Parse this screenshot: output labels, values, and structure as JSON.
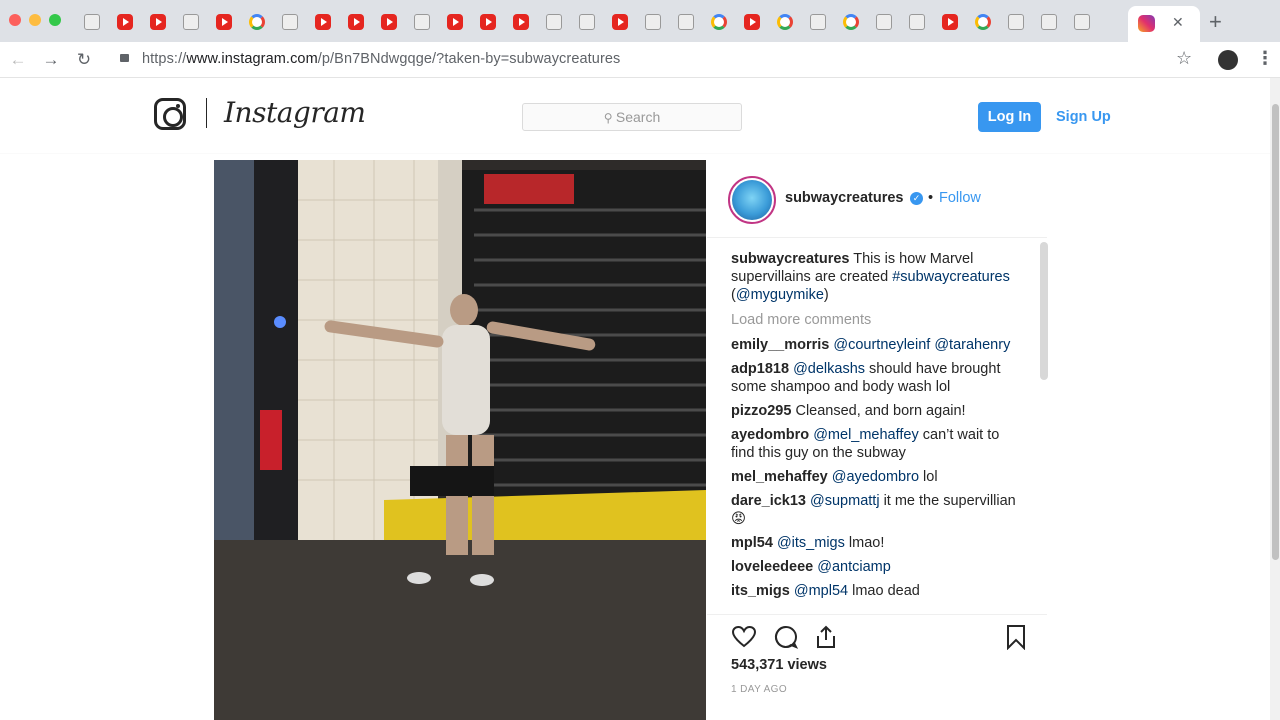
{
  "browser": {
    "url_prefix": "https://",
    "url_domain": "www.instagram.com",
    "url_path": "/p/Bn7BNdwgqge/?taken-by=subwaycreatures",
    "tab_close": "✕",
    "new_tab": "+"
  },
  "header": {
    "wordmark": "Instagram",
    "search_placeholder": "Search",
    "login_label": "Log In",
    "signup_label": "Sign Up"
  },
  "post": {
    "author": "subwaycreatures",
    "separator": "•",
    "follow_label": "Follow",
    "views": "543,371 views",
    "time": "1 DAY AGO",
    "caption": {
      "user": "subwaycreatures",
      "text": " This is how Marvel supervillains are created ",
      "hashtag": "#subwaycreatures",
      "open": " (",
      "mention": "@myguymike",
      "close": ")"
    },
    "load_more": "Load more comments",
    "comments": [
      {
        "user": "emily__morris",
        "mention": "@courtneyleinf @tarahenry",
        "text": ""
      },
      {
        "user": "adp1818",
        "mention": "@delkashs",
        "text": " should have brought some shampoo and body wash lol"
      },
      {
        "user": "pizzo295",
        "mention": "",
        "text": "Cleansed, and born again!"
      },
      {
        "user": "ayedombro",
        "mention": "@mel_mehaffey",
        "text": " can’t wait to find this guy on the subway"
      },
      {
        "user": "mel_mehaffey",
        "mention": "@ayedombro",
        "text": " lol"
      },
      {
        "user": "dare_ick13",
        "mention": "@supmattj",
        "text": " it me the supervillian 😡"
      },
      {
        "user": "mpl54",
        "mention": "@its_migs",
        "text": " lmao!"
      },
      {
        "user": "loveleedeee",
        "mention": "@antciamp",
        "text": ""
      },
      {
        "user": "its_migs",
        "mention": "@mpl54",
        "text": " lmao dead"
      }
    ]
  },
  "colors": {
    "accent": "#3897f0",
    "mention": "#003569",
    "muted": "#999999"
  }
}
